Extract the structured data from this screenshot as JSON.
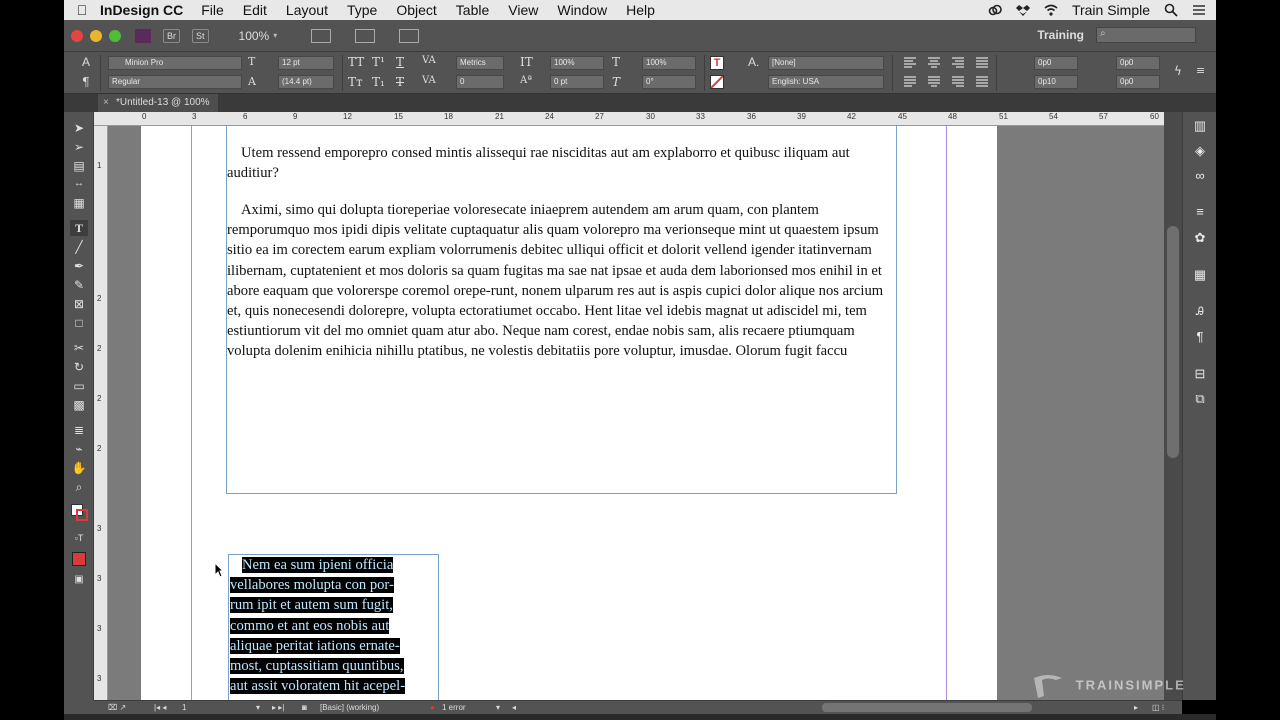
{
  "menubar": {
    "app": "InDesign CC",
    "items": [
      "File",
      "Edit",
      "Layout",
      "Type",
      "Object",
      "Table",
      "View",
      "Window",
      "Help"
    ],
    "user": "Train Simple"
  },
  "appbar": {
    "bridge_label": "Br",
    "stock_label": "St",
    "zoom": "100%",
    "workspace": "Training"
  },
  "control": {
    "font_family": "Minion Pro",
    "font_style": "Regular",
    "font_size": "12 pt",
    "leading": "(14.4 pt)",
    "kerning": "Metrics",
    "tracking": "0",
    "vscale": "100%",
    "hscale": "100%",
    "baseline": "0 pt",
    "skew": "0°",
    "char_style": "[None]",
    "language": "English: USA",
    "indent_left": "0p0",
    "indent_right": "0p0",
    "indent_first": "0p10",
    "space_after": "0p0"
  },
  "tab": {
    "title": "*Untitled-13 @ 100%"
  },
  "ruler": {
    "h_labels": [
      "0",
      "3",
      "6",
      "9",
      "12",
      "15",
      "18",
      "21",
      "24",
      "27",
      "30",
      "33",
      "36",
      "39",
      "42",
      "45",
      "48",
      "51",
      "54",
      "57",
      "60"
    ],
    "v_labels": [
      "1",
      "2",
      "2",
      "2",
      "2",
      "3",
      "3",
      "3",
      "3"
    ]
  },
  "document": {
    "para1": "Utem ressend emporepro consed mintis alissequi rae nisciditas aut am explaborro et quibusc iliquam aut auditiur?",
    "para2": "Aximi, simo qui dolupta tioreperiae voloresecate iniaeprem autendem am arum quam, con plantem remporumquo mos ipidi dipis velitate cuptaquatur alis quam volorepro ma verionseque mint ut quaestem ipsum sitio ea im corectem earum expliam volorrumenis debitec ulliqui officit et dolorit vellend igender itatinvernam ilibernam, cuptatenient et mos doloris sa quam fugitas ma sae nat ipsae et auda dem laborionsed mos enihil in et abore eaquam que volorerspe coremol orepe-runt, nonem ulparum res aut is aspis cupici dolor alique nos arcium et, quis nonecesendi dolorepre, volupta ectoratiumet occabo. Hent litae vel idebis magnat ut adiscidel mi, tem estiuntiorum vit del mo omniet quam atur abo. Neque nam corest, endae nobis sam, alis recaere ptiumquam volupta dolenim enihicia nihillu ptatibus, ne volestis debitatiis pore voluptur, imusdae. Olorum fugit faccu",
    "selected_lines": [
      "Nem ea sum ipieni officia",
      "vellabores molupta con por-",
      "rum ipit et autem sum fugit,",
      "commo et ant eos nobis aut",
      "aliquae peritat iations ernate-",
      "most, cuptassitiam quuntibus,",
      "aut assit voloratem hit acepel-"
    ]
  },
  "status": {
    "page": "1",
    "style": "[Basic] (working)",
    "errors": "1 error"
  },
  "watermark": "TRAINSIMPLE",
  "colors": {
    "ui_dark": "#535353",
    "accent_red": "#d93a3a",
    "selection_text": "#bde8ff",
    "frame_edge": "#7aa2c8",
    "guide": "#b48ad6"
  }
}
